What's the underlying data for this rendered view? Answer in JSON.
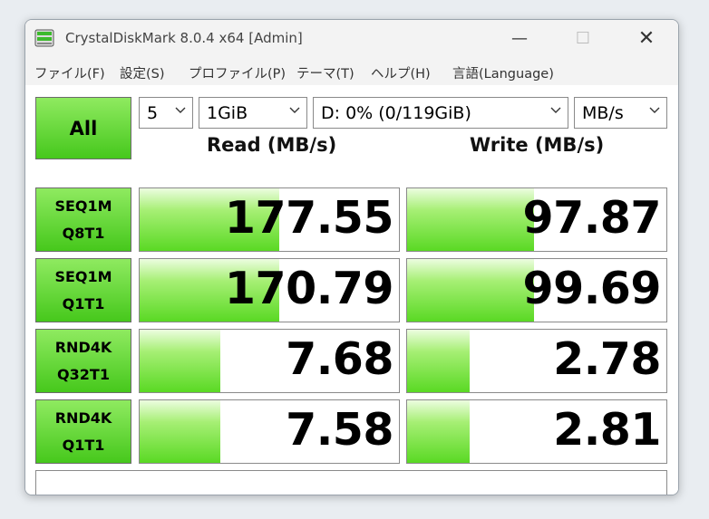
{
  "window": {
    "title": "CrystalDiskMark 8.0.4 x64 [Admin]",
    "controls": {
      "minimize": "—",
      "maximize": "☐",
      "close": "✕"
    }
  },
  "menu": [
    "ファイル(F)",
    "設定(S)",
    "プロファイル(P)",
    "テーマ(T)",
    "ヘルプ(H)",
    "言語(Language)"
  ],
  "toolbar": {
    "all_label": "All",
    "count": "5",
    "size": "1GiB",
    "drive": "D: 0% (0/119GiB)",
    "unit": "MB/s"
  },
  "headers": {
    "read": "Read (MB/s)",
    "write": "Write (MB/s)"
  },
  "rows": [
    {
      "line1": "SEQ1M",
      "line2": "Q8T1",
      "read": "177.55",
      "write": "97.87",
      "read_fill": 0.54,
      "write_fill": 0.49
    },
    {
      "line1": "SEQ1M",
      "line2": "Q1T1",
      "read": "170.79",
      "write": "99.69",
      "read_fill": 0.54,
      "write_fill": 0.49
    },
    {
      "line1": "RND4K",
      "line2": "Q32T1",
      "read": "7.68",
      "write": "2.78",
      "read_fill": 0.31,
      "write_fill": 0.24
    },
    {
      "line1": "RND4K",
      "line2": "Q1T1",
      "read": "7.58",
      "write": "2.81",
      "read_fill": 0.31,
      "write_fill": 0.24
    }
  ],
  "comment": "",
  "colors": {
    "accent_green": "#5ad924",
    "button_green": "#46c81c"
  },
  "icons": {
    "app": "disk-drive-icon",
    "dropdown": "chevron-down-icon"
  }
}
